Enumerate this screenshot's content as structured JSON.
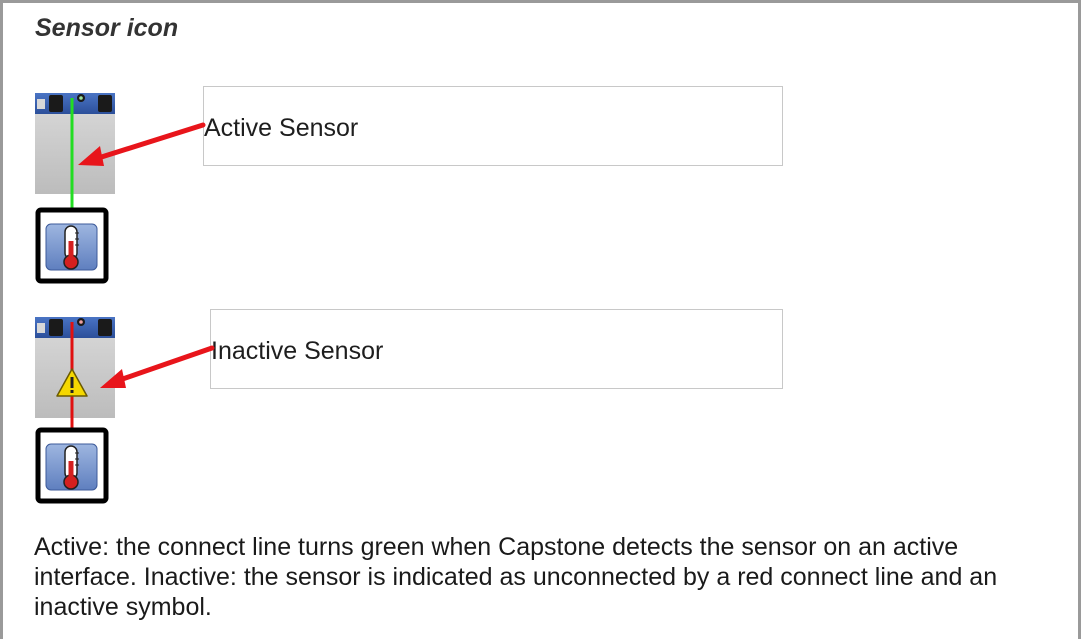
{
  "heading": "Sensor icon",
  "active": {
    "label": "Active Sensor",
    "line_color": "#22dd22",
    "icon": "thermometer-icon"
  },
  "inactive": {
    "label": "Inactive Sensor",
    "line_color": "#e01010",
    "icon": "thermometer-icon",
    "status_icon": "warning-icon"
  },
  "arrow_color": "#e8151b",
  "description": "Active: the connect line turns green when Capstone detects the sensor on an active interface. Inactive: the sensor is indicated as unconnected by a red connect line and an inactive symbol."
}
